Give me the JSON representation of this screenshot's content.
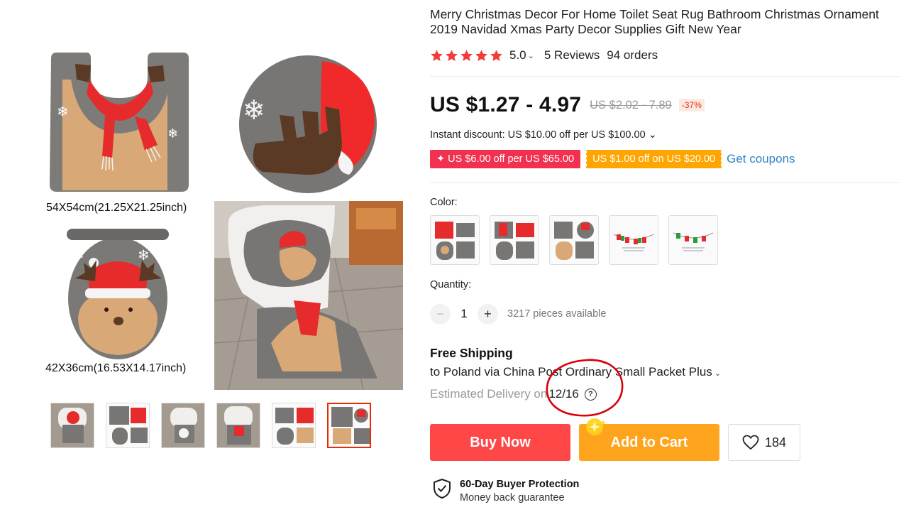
{
  "gallery": {
    "caption_top": "54X54cm(21.25X21.25inch)",
    "caption_bottom": "42X36cm(16.53X14.17inch)",
    "thumbnails": [
      "thumb-1",
      "thumb-2",
      "thumb-3",
      "thumb-4",
      "thumb-5",
      "thumb-6"
    ],
    "active_thumbnail_index": 5
  },
  "product": {
    "title": "Merry Christmas Decor For Home Toilet Seat Rug Bathroom Christmas Ornament 2019 Navidad Xmas Party Decor Supplies Gift New Year",
    "rating": {
      "stars": 5,
      "value": "5.0",
      "chevron": "⌄",
      "reviews": "5 Reviews",
      "orders": "94 orders"
    },
    "price": {
      "current": "US $1.27 - 4.97",
      "original": "US $2.02 - 7.89",
      "discount": "-37%"
    },
    "instant_discount": "Instant discount: US $10.00 off per US $100.00 ⌄",
    "coupons": {
      "red": "✦ US $6.00 off per US $65.00",
      "orange": "US $1.00 off on US $20.00",
      "get_label": "Get coupons"
    },
    "color": {
      "label": "Color:",
      "options": [
        "variant-1",
        "variant-2",
        "variant-3",
        "variant-4",
        "variant-5"
      ]
    },
    "quantity": {
      "label": "Quantity:",
      "minus": "−",
      "value": "1",
      "plus": "+",
      "available": "3217 pieces available"
    },
    "shipping": {
      "title": "Free Shipping",
      "destination": "to Poland via China Post Ordinary Small Packet Plus",
      "chevron": "⌄",
      "estimate_label": "Estimated Delivery on",
      "estimate_date": "12/16",
      "help": "?"
    },
    "actions": {
      "buy_now": "Buy Now",
      "add_to_cart": "Add to Cart",
      "wishlist_count": "184"
    },
    "protection": {
      "title": "60-Day Buyer Protection",
      "subtitle": "Money back guarantee"
    }
  },
  "colors": {
    "accent_red": "#ff4747",
    "accent_orange": "#ffa41c",
    "star": "#f23c3c",
    "link_blue": "#2e83c6",
    "annotation_circle": "#d8000c"
  }
}
